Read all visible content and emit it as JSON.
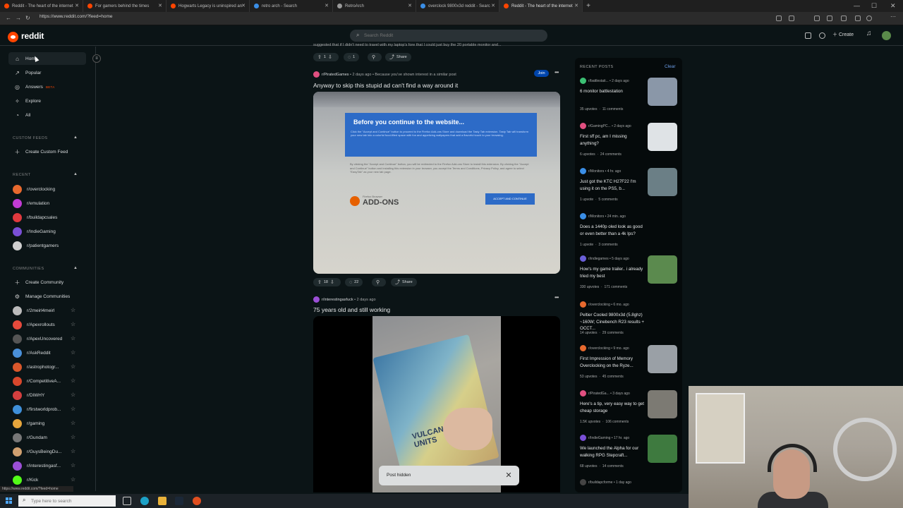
{
  "browser": {
    "tabs": [
      {
        "title": "Reddit - The heart of the internet",
        "color": "#ff4500",
        "active": false
      },
      {
        "title": "For gamers behind the times",
        "color": "#ff4500",
        "active": false
      },
      {
        "title": "Hogwarts Legacy is uninspired an",
        "color": "#ff4500",
        "active": false
      },
      {
        "title": "retro arch - Search",
        "color": "#3a8ee6",
        "active": false
      },
      {
        "title": "RetroArch",
        "color": "#999999",
        "active": false
      },
      {
        "title": "overclock 9800x3d reddit - Searc",
        "color": "#3a8ee6",
        "active": false
      },
      {
        "title": "Reddit - The heart of the internet",
        "color": "#ff4500",
        "active": true
      }
    ],
    "new_tab": "+",
    "url": "https://www.reddit.com/?feed=home"
  },
  "header": {
    "logo_text": "reddit",
    "search_placeholder": "Search Reddit",
    "create_label": "Create"
  },
  "sidebar": {
    "nav": [
      {
        "label": "Home",
        "icon": "home-icon",
        "glyph": "⌂"
      },
      {
        "label": "Popular",
        "icon": "popular-icon",
        "glyph": "↗"
      },
      {
        "label": "Answers",
        "icon": "answers-icon",
        "glyph": "◎",
        "badge": "BETA"
      },
      {
        "label": "Explore",
        "icon": "explore-icon",
        "glyph": "✧"
      },
      {
        "label": "All",
        "icon": "all-icon",
        "glyph": "◔"
      }
    ],
    "custom_feeds_heading": "CUSTOM FEEDS",
    "create_custom_feed": "Create Custom Feed",
    "recent_heading": "RECENT",
    "recent": [
      {
        "name": "r/overclocking",
        "color": "#e8692e"
      },
      {
        "name": "r/emulation",
        "color": "#c23bd4"
      },
      {
        "name": "r/buildapcsales",
        "color": "#e0393e"
      },
      {
        "name": "r/IndieGaming",
        "color": "#7a4fd6"
      },
      {
        "name": "r/patientgamers",
        "color": "#cfcfcf"
      }
    ],
    "communities_heading": "COMMUNITIES",
    "create_community": "Create Community",
    "manage_communities": "Manage Communities",
    "communities": [
      {
        "name": "r/2meirl4meirl",
        "color": "#bbbbbb"
      },
      {
        "name": "r/Apexrollouts",
        "color": "#e64a3c"
      },
      {
        "name": "r/ApexUncovered",
        "color": "#555555"
      },
      {
        "name": "r/AskReddit",
        "color": "#4a90d9"
      },
      {
        "name": "r/astrophotogr...",
        "color": "#d9572b"
      },
      {
        "name": "r/CompetitiveA...",
        "color": "#d8472c"
      },
      {
        "name": "r/DiWHY",
        "color": "#d43f3f"
      },
      {
        "name": "r/firstworldprob...",
        "color": "#3f8fd8"
      },
      {
        "name": "r/gaming",
        "color": "#e6a53c"
      },
      {
        "name": "r/Gundam",
        "color": "#777777"
      },
      {
        "name": "r/GuysBeingDu...",
        "color": "#d0a070"
      },
      {
        "name": "r/interestingasf...",
        "color": "#9b4fd6"
      },
      {
        "name": "r/Kick",
        "color": "#53fc18"
      }
    ]
  },
  "feed": {
    "top_snippet": "suggested that if I didn't need to travel with my laptop's fore that I could just buy the 20 portable monitor and...",
    "top_actions": {
      "votes": "1",
      "comments": "1",
      "share": "Share"
    },
    "post1": {
      "subreddit": "r/PiratedGames",
      "time": "• 2 days ago",
      "reason": "• Because you've shown interest in a similar post",
      "join": "Join",
      "title": "Anyway to skip this stupid ad can't find a way around it",
      "image": {
        "heading": "Before you continue to the website...",
        "blue_text": "Click the \"Accept and Continue\" button to proceed to the Firefox Add-ons Store and download the Tasty Tab extension. Tasty Tab will transform your new tab into a colorful food-filled space with fun and appetizing wallpapers that add a flavorful touch to your browsing.",
        "body_text": "By clicking the \"Accept and Continue\" button, you will be redirected to the Firefox Add-ons Store to install this extension. By clicking the \"Accept and Continue\" button and installing this extension in your browser, you accept the Terms and Conditions, Privacy Policy, and agree to select \"EasyTab\" as your new tab page.",
        "ff_small": "Firefox Browser",
        "ff_big": "ADD-ONS",
        "accept": "ACCEPT AND CONTINUE"
      },
      "votes": "18",
      "comments": "22",
      "share": "Share"
    },
    "post2": {
      "subreddit": "r/interestingasfuck",
      "time": "• 2 days ago",
      "title": "75 years old and still working",
      "box_text": "VULCANIZING PATCH UNITS"
    },
    "toast": "Post hidden"
  },
  "recent_posts": {
    "heading": "RECENT POSTS",
    "clear": "Clear",
    "items": [
      {
        "sub": "r/battlestati...",
        "time": "• 2 days ago",
        "title": "6 monitor battlestation",
        "upvotes": "35 upvotes",
        "comments": "11 comments",
        "color": "#3bbf73",
        "thumb": "#8a97a8"
      },
      {
        "sub": "r/GamingPC...",
        "time": "• 2 days ago",
        "title": "First sff pc, am I missing anything?",
        "upvotes": "6 upvotes",
        "comments": "24 comments",
        "color": "#e04f80",
        "thumb": "#dfe3e6"
      },
      {
        "sub": "r/Monitors",
        "time": "• 4 hr. ago",
        "title": "Just got the KTC H27F22 I'm using it on the PS5, b...",
        "upvotes": "1 upvote",
        "comments": "5 comments",
        "color": "#3a8ee6",
        "thumb": "#6b7f86"
      },
      {
        "sub": "r/Monitors",
        "time": "• 24 min. ago",
        "title": "Does a 1440p oled look as good or even better than a 4k Ips?",
        "upvotes": "1 upvote",
        "comments": "3 comments",
        "color": "#3a8ee6",
        "thumb": ""
      },
      {
        "sub": "r/indiegames",
        "time": "• 5 days ago",
        "title": "How's my game trailer.. i already tried my best",
        "upvotes": "330 upvotes",
        "comments": "171 comments",
        "color": "#6a5fd8",
        "thumb": "#5b8a4e"
      },
      {
        "sub": "r/overclocking",
        "time": "• 6 mo. ago",
        "title": "Peltier Cooled 9800x3d (5.8ghz) ~160W; Cinebench R23 results + OCCT...",
        "upvotes": "14 upvotes",
        "comments": "29 comments",
        "color": "#e8692e",
        "thumb": ""
      },
      {
        "sub": "r/overclocking",
        "time": "• 9 mo. ago",
        "title": "First Impression of Memory Overclocking on the Ryze...",
        "upvotes": "53 upvotes",
        "comments": "45 comments",
        "color": "#e8692e",
        "thumb": "#9aa0a6"
      },
      {
        "sub": "r/PiratedGa...",
        "time": "• 3 days ago",
        "title": "Here's a tip, very easy way to get cheap storage",
        "upvotes": "1.5K upvotes",
        "comments": "106 comments",
        "color": "#e04f80",
        "thumb": "#7c7a73"
      },
      {
        "sub": "r/IndieGaming",
        "time": "• 17 hr. ago",
        "title": "We launched the Alpha for our walking RPG Stepcraft...",
        "upvotes": "68 upvotes",
        "comments": "14 comments",
        "color": "#7a4fd6",
        "thumb": "#3e7a3f"
      },
      {
        "sub": "r/buildapcforme",
        "time": "• 1 day ago",
        "title": "",
        "upvotes": "",
        "comments": "",
        "color": "#444444",
        "thumb": ""
      }
    ]
  },
  "status_url": "https://www.reddit.com/?feed=home",
  "taskbar": {
    "search_placeholder": "Type here to search"
  }
}
